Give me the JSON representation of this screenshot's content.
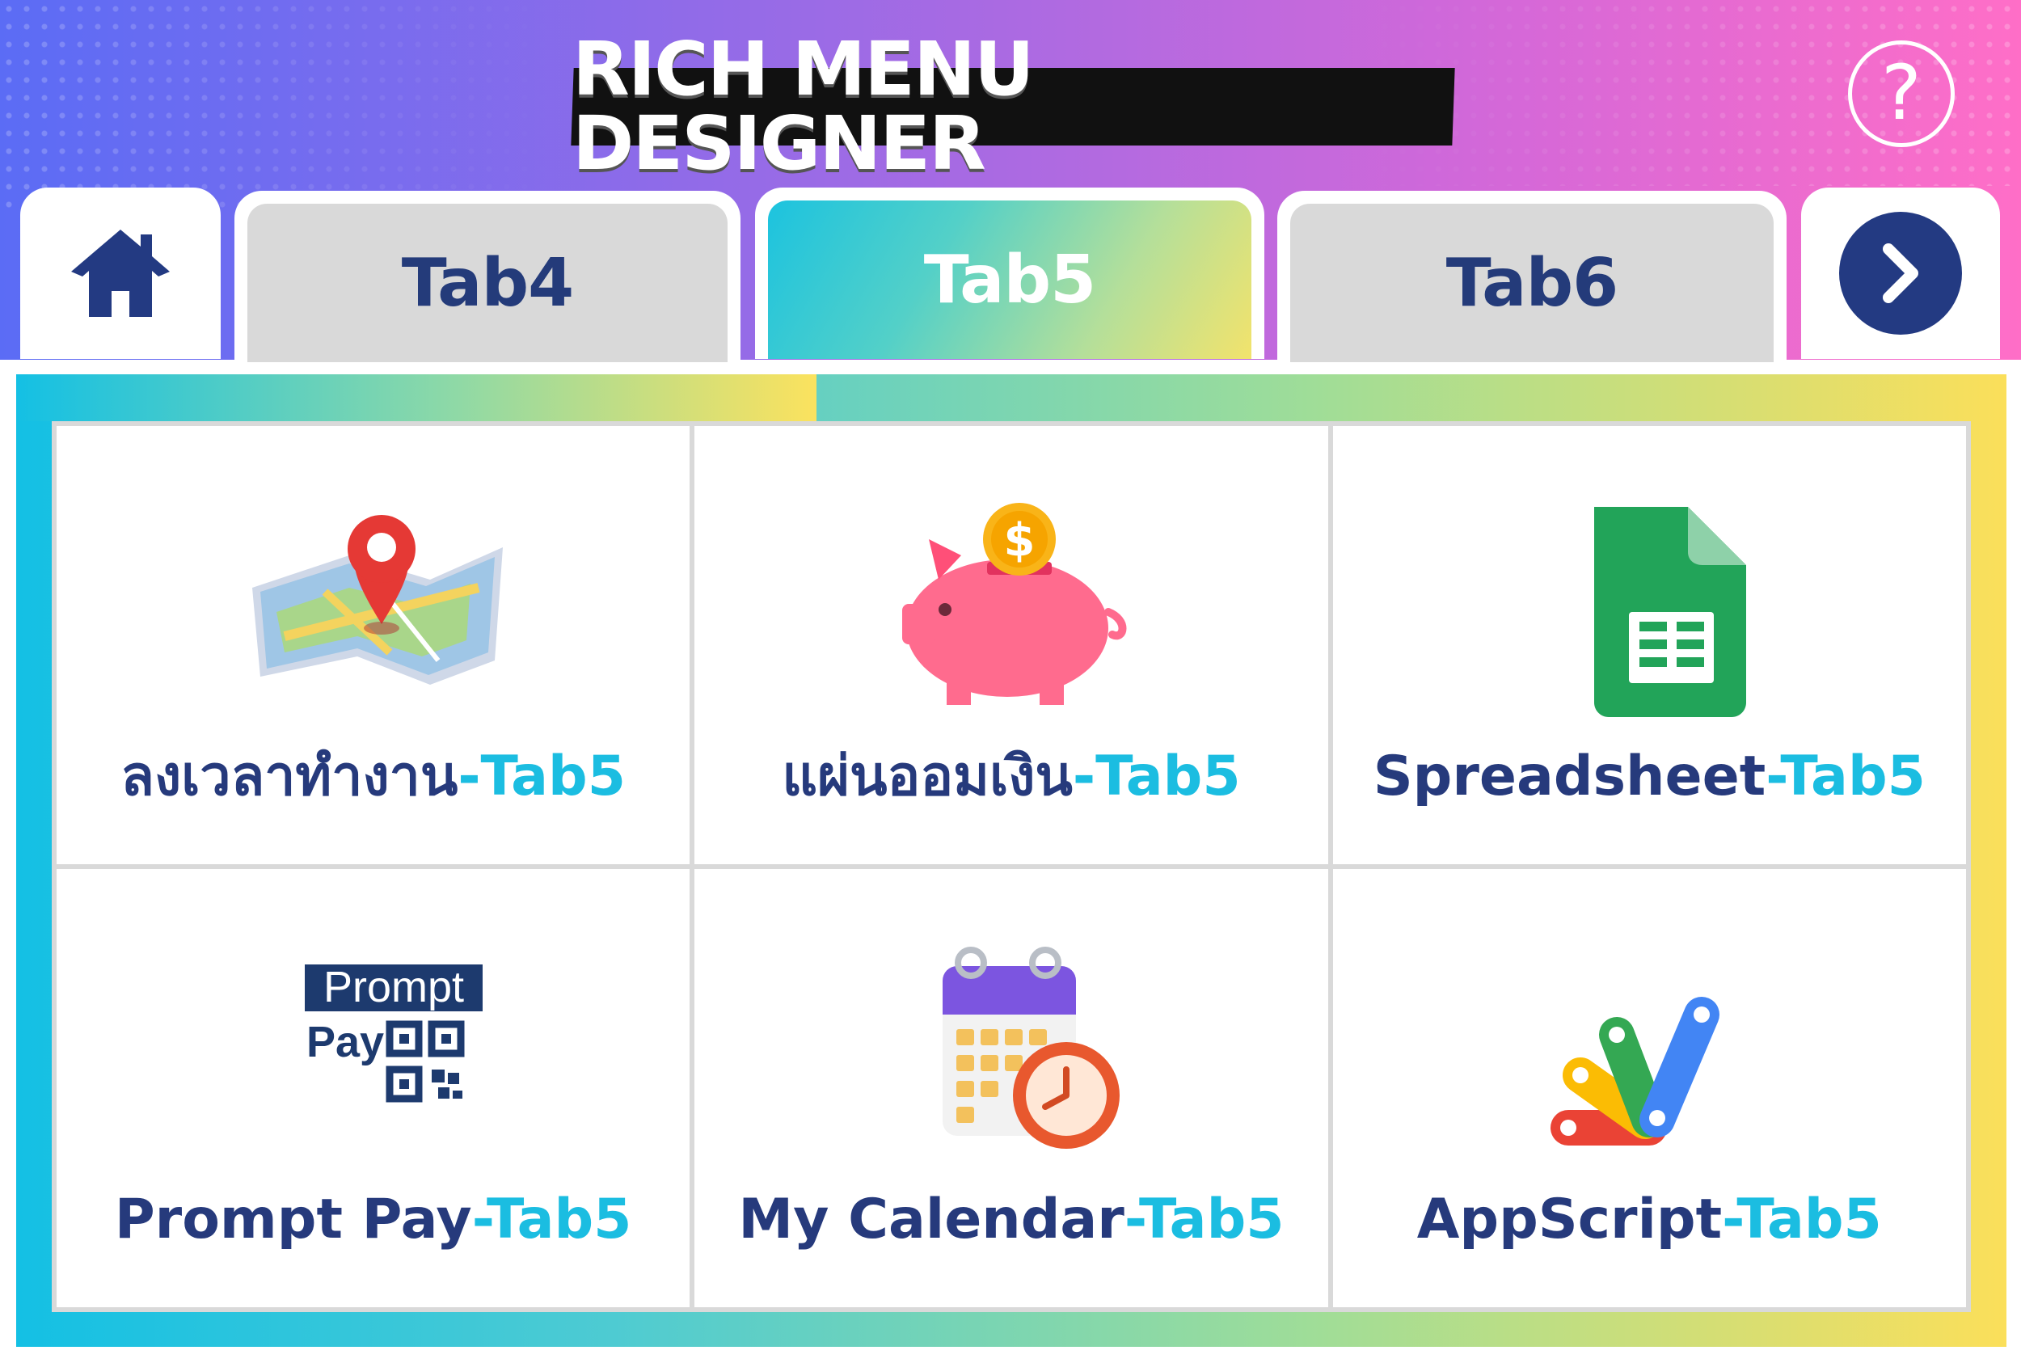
{
  "header": {
    "title": "RICH MENU DESIGNER",
    "help_label": "?"
  },
  "tabs": [
    {
      "label": "Tab4",
      "state": "inactive"
    },
    {
      "label": "Tab5",
      "state": "active"
    },
    {
      "label": "Tab6",
      "state": "inactive"
    }
  ],
  "colors": {
    "header_gradient": [
      "#5b6cf5",
      "#ff6ec7"
    ],
    "accent_navy": "#233a82",
    "accent_cyan": "#1bbde1",
    "frame_gradient": [
      "#14c0e4",
      "#fbdf5a"
    ]
  },
  "menu": {
    "items": [
      {
        "name": "ลงเวลาทำงาน",
        "suffix": "-Tab5",
        "icon": "map-pin-icon"
      },
      {
        "name": "แผ่นออมเงิน",
        "suffix": "-Tab5",
        "icon": "piggy-bank-icon"
      },
      {
        "name": "Spreadsheet",
        "suffix": "-Tab5",
        "icon": "google-sheets-icon"
      },
      {
        "name": "Prompt Pay",
        "suffix": "-Tab5",
        "icon": "promptpay-icon"
      },
      {
        "name": "My Calendar",
        "suffix": "-Tab5",
        "icon": "calendar-clock-icon"
      },
      {
        "name": "AppScript",
        "suffix": "-Tab5",
        "icon": "apps-script-icon"
      }
    ]
  },
  "icons": {
    "promptpay_line1": "Prompt",
    "promptpay_line2": "Pay",
    "piggy_coin": "$"
  }
}
